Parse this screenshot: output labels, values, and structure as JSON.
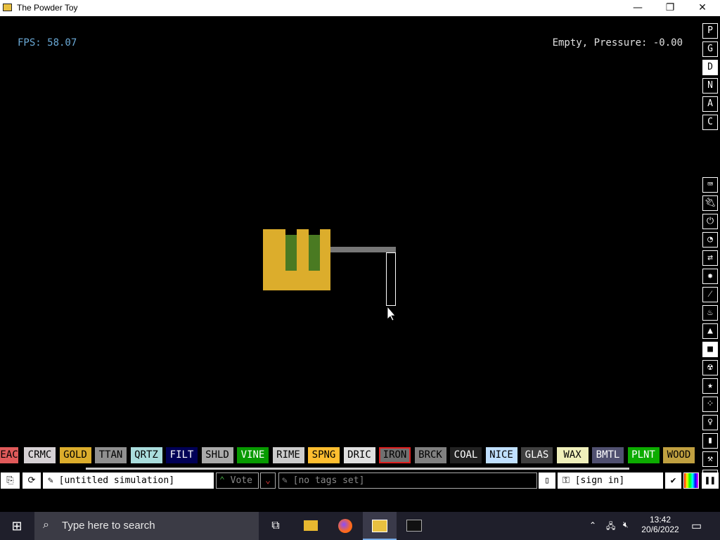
{
  "window": {
    "title": "The Powder Toy",
    "minimize": "—",
    "maximize": "❐",
    "close": "✕"
  },
  "hud": {
    "fps": "FPS: 58.07",
    "status": "Empty, Pressure: -0.00"
  },
  "right_menu_top": [
    "P",
    "G",
    "D",
    "N",
    "A",
    "C"
  ],
  "right_menu_icons": [
    "keyboard-icon",
    "plug-icon",
    "power-icon",
    "pressure-gauge-icon",
    "force-arrows-icon",
    "explosive-icon",
    "pipe-icon",
    "fire-drop-icon",
    "gas-flask-icon",
    "solid-square-icon",
    "radioactive-icon",
    "star-icon",
    "powder-dots-icon",
    "lightbulb-icon",
    "bookmark-icon",
    "tools-icon",
    "search-icon"
  ],
  "elements": [
    {
      "label": "EAC",
      "bg": "#e05a5a",
      "fg": "#000"
    },
    {
      "label": "CRMC",
      "bg": "#d6d1d4",
      "fg": "#000"
    },
    {
      "label": "GOLD",
      "bg": "#dcad2c",
      "fg": "#000"
    },
    {
      "label": "TTAN",
      "bg": "#909090",
      "fg": "#000"
    },
    {
      "label": "QRTZ",
      "bg": "#aadddd",
      "fg": "#000"
    },
    {
      "label": "FILT",
      "bg": "#000056",
      "fg": "#fff"
    },
    {
      "label": "SHLD",
      "bg": "#aaaaaa",
      "fg": "#000"
    },
    {
      "label": "VINE",
      "bg": "#079a00",
      "fg": "#fff"
    },
    {
      "label": "RIME",
      "bg": "#cccccc",
      "fg": "#000"
    },
    {
      "label": "SPNG",
      "bg": "#ffbe30",
      "fg": "#000"
    },
    {
      "label": "DRIC",
      "bg": "#e0e0e0",
      "fg": "#000"
    },
    {
      "label": "IRON",
      "bg": "#707070",
      "fg": "#000"
    },
    {
      "label": "BRCK",
      "bg": "#808080",
      "fg": "#000"
    },
    {
      "label": "COAL",
      "bg": "#222222",
      "fg": "#fff"
    },
    {
      "label": "NICE",
      "bg": "#c0e0ff",
      "fg": "#000"
    },
    {
      "label": "GLAS",
      "bg": "#404040",
      "fg": "#fff"
    },
    {
      "label": "WAX",
      "bg": "#f0f0bb",
      "fg": "#000"
    },
    {
      "label": "BMTL",
      "bg": "#505070",
      "fg": "#fff"
    },
    {
      "label": "PLNT",
      "bg": "#0cac00",
      "fg": "#fff"
    },
    {
      "label": "WOOD",
      "bg": "#c0a040",
      "fg": "#000"
    }
  ],
  "selected_element": "IRON",
  "bottom": {
    "sim_name": "[untitled simulation]",
    "vote": "Vote",
    "tags": "[no tags set]",
    "sign_in": "[sign in]"
  },
  "taskbar": {
    "search_placeholder": "Type here to search",
    "time": "13:42",
    "date": "20/6/2022"
  }
}
